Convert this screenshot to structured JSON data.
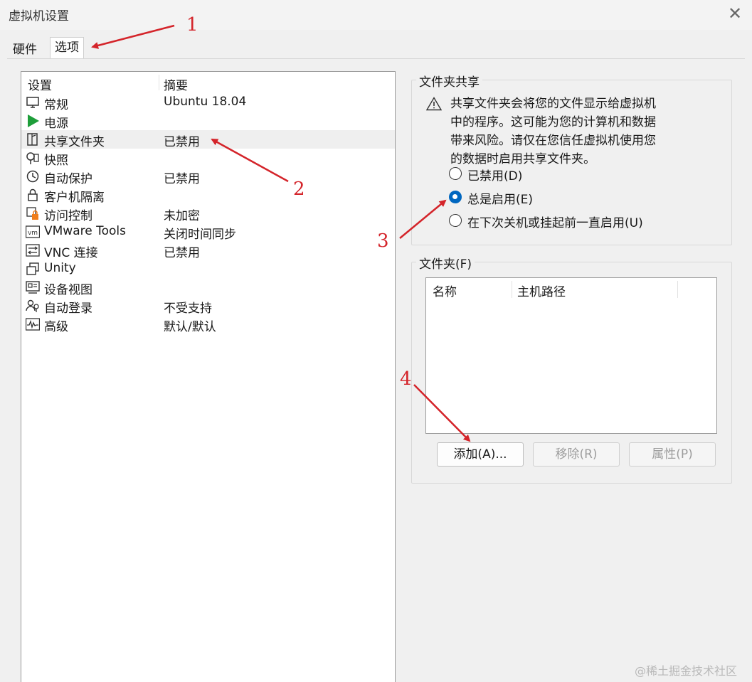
{
  "window": {
    "title": "虚拟机设置",
    "close_glyph": "✕"
  },
  "tabs": [
    {
      "label": "硬件"
    },
    {
      "label": "选项"
    }
  ],
  "settings_list": {
    "columns": [
      "设置",
      "摘要"
    ],
    "rows": [
      {
        "name": "常规",
        "summary": "Ubuntu 18.04",
        "icon": "monitor-icon"
      },
      {
        "name": "电源",
        "summary": "",
        "icon": "power-play-icon"
      },
      {
        "name": "共享文件夹",
        "summary": "已禁用",
        "icon": "shared-folder-icon",
        "selected": true
      },
      {
        "name": "快照",
        "summary": "",
        "icon": "snapshot-icon"
      },
      {
        "name": "自动保护",
        "summary": "已禁用",
        "icon": "clock-icon"
      },
      {
        "name": "客户机隔离",
        "summary": "",
        "icon": "lock-icon"
      },
      {
        "name": "访问控制",
        "summary": "未加密",
        "icon": "access-control-icon"
      },
      {
        "name": "VMware Tools",
        "summary": "关闭时间同步",
        "icon": "vm-icon"
      },
      {
        "name": "VNC 连接",
        "summary": "已禁用",
        "icon": "vnc-icon"
      },
      {
        "name": "Unity",
        "summary": "",
        "icon": "unity-icon"
      },
      {
        "name": "设备视图",
        "summary": "",
        "icon": "device-view-icon"
      },
      {
        "name": "自动登录",
        "summary": "不受支持",
        "icon": "users-icon"
      },
      {
        "name": "高级",
        "summary": "默认/默认",
        "icon": "advanced-icon"
      }
    ]
  },
  "sharing_group": {
    "legend": "文件夹共享",
    "warning_icon": "warning-icon",
    "warning_lines": [
      "共享文件夹会将您的文件显示给虚拟机",
      "中的程序。这可能为您的计算机和数据",
      "带来风险。请仅在您信任虚拟机使用您",
      "的数据时启用共享文件夹。"
    ],
    "options": [
      {
        "label": "已禁用(D)",
        "checked": false
      },
      {
        "label": "总是启用(E)",
        "checked": true
      },
      {
        "label": "在下次关机或挂起前一直启用(U)",
        "checked": false
      }
    ]
  },
  "folders_group": {
    "legend": "文件夹(F)",
    "columns": [
      "名称",
      "主机路径"
    ],
    "buttons": {
      "add": "添加(A)...",
      "remove": "移除(R)",
      "properties": "属性(P)"
    }
  },
  "annotations": [
    "1",
    "2",
    "3",
    "4"
  ],
  "watermark": "@稀土掘金技术社区",
  "colors": {
    "accent": "#0067c0",
    "annotation": "#d4242a",
    "power": "#1e9e3a"
  }
}
